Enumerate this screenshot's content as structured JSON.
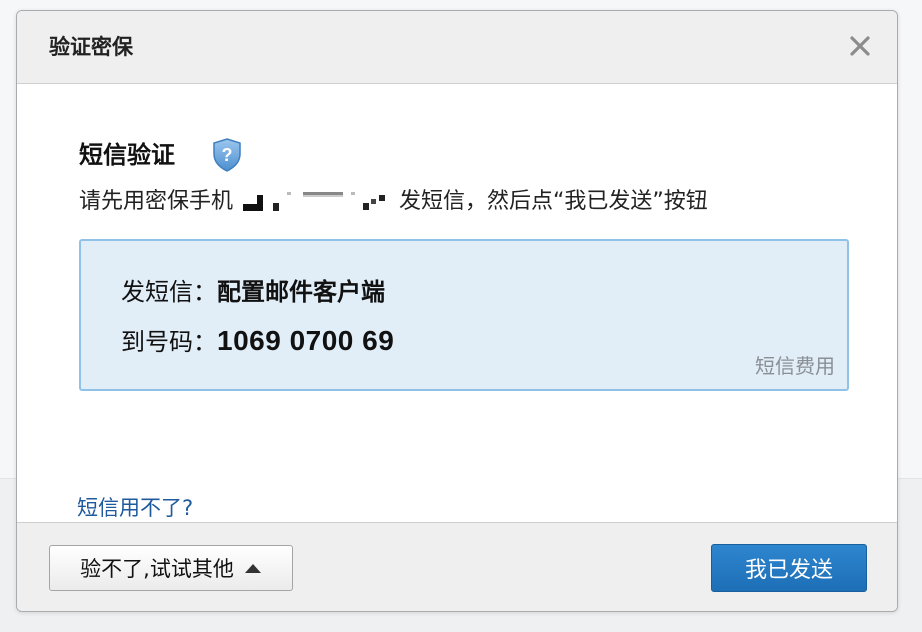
{
  "dialog": {
    "title": "验证密保",
    "close_icon": "close-icon"
  },
  "sms_verify": {
    "heading": "短信验证",
    "heading_icon": "shield-question-icon",
    "instruction_before": "请先用密保手机",
    "instruction_after": "发短信，然后点“我已发送”按钮",
    "box": {
      "send_label": "发短信：",
      "send_value": "配置邮件客户端",
      "to_label": "到号码：",
      "to_value": "1069 0700 69",
      "fee_link": "短信费用"
    },
    "help_link": "短信用不了?"
  },
  "footer": {
    "other_button": "验不了,试试其他",
    "other_button_icon": "caret-up-icon",
    "sent_button": "我已发送"
  },
  "colors": {
    "primary": "#1d6fb6",
    "box_bg": "#e1edf7",
    "box_border": "#8fc2e6",
    "link": "#1f5a9d"
  }
}
